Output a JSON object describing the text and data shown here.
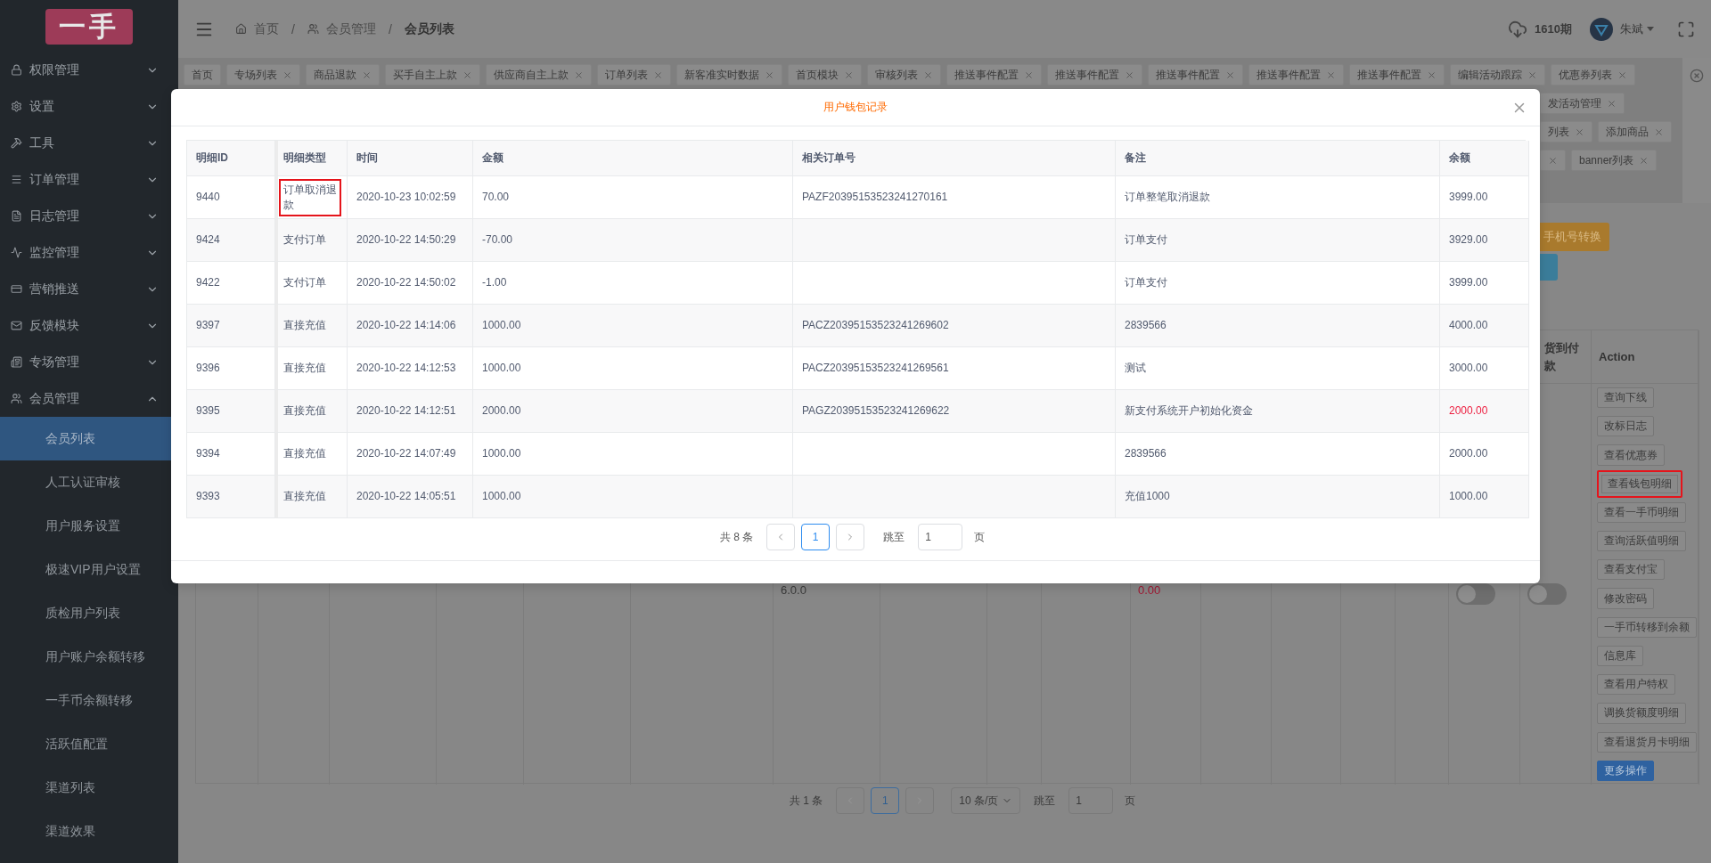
{
  "sidebar": {
    "logo": "一手",
    "items": [
      {
        "label": "权限管理",
        "expanded": false
      },
      {
        "label": "设置",
        "expanded": false
      },
      {
        "label": "工具",
        "expanded": false
      },
      {
        "label": "订单管理",
        "expanded": false
      },
      {
        "label": "日志管理",
        "expanded": false
      },
      {
        "label": "监控管理",
        "expanded": false
      },
      {
        "label": "营销推送",
        "expanded": false
      },
      {
        "label": "反馈模块",
        "expanded": false
      },
      {
        "label": "专场管理",
        "expanded": false
      },
      {
        "label": "会员管理",
        "expanded": true,
        "children": [
          {
            "label": "会员列表",
            "selected": true
          },
          {
            "label": "人工认证审核",
            "selected": false
          },
          {
            "label": "用户服务设置",
            "selected": false
          },
          {
            "label": "极速VIP用户设置",
            "selected": false
          },
          {
            "label": "质检用户列表",
            "selected": false
          },
          {
            "label": "用户账户余额转移",
            "selected": false
          },
          {
            "label": "一手币余额转移",
            "selected": false
          },
          {
            "label": "活跃值配置",
            "selected": false
          },
          {
            "label": "渠道列表",
            "selected": false
          },
          {
            "label": "渠道效果",
            "selected": false
          }
        ]
      }
    ]
  },
  "header": {
    "breadcrumb": [
      {
        "label": "首页",
        "current": false
      },
      {
        "label": "会员管理",
        "current": false
      },
      {
        "label": "会员列表",
        "current": true
      }
    ],
    "separators": [
      "/",
      "/"
    ],
    "period": "1610期",
    "user": "朱斌"
  },
  "tab_rows": [
    {
      "tabs": [
        {
          "label": "首页",
          "closable": false
        },
        {
          "label": "专场列表",
          "closable": true
        },
        {
          "label": "商品退款",
          "closable": true
        },
        {
          "label": "买手自主上款",
          "closable": true
        },
        {
          "label": "供应商自主上款",
          "closable": true
        },
        {
          "label": "订单列表",
          "closable": true
        },
        {
          "label": "新客准实时数据",
          "closable": true
        },
        {
          "label": "首页模块",
          "closable": true
        },
        {
          "label": "审核列表",
          "closable": true
        },
        {
          "label": "推送事件配置",
          "closable": true
        },
        {
          "label": "推送事件配置",
          "closable": true
        },
        {
          "label": "推送事件配置",
          "closable": true
        },
        {
          "label": "推送事件配置",
          "closable": true
        },
        {
          "label": "推送事件配置",
          "closable": true
        },
        {
          "label": "编辑活动跟踪",
          "closable": true
        },
        {
          "label": "优惠券列表",
          "closable": true
        }
      ]
    },
    {
      "tabs": [
        {
          "label": "发活动管理",
          "closable": true
        }
      ]
    },
    {
      "tabs": [
        {
          "label": "列表",
          "closable": true
        },
        {
          "label": "添加商品",
          "closable": true
        }
      ]
    },
    {
      "tabs": [
        {
          "closable": true
        },
        {
          "label": "banner列表",
          "closable": true
        }
      ]
    }
  ],
  "side_buttons": [
    {
      "label": "手机号转换",
      "kind": "warning"
    },
    {
      "kind": "primary"
    }
  ],
  "member_table": {
    "columns": [
      {},
      {},
      {},
      {},
      {},
      {},
      {
        "cell": {
          "kind": "text",
          "text": "6.0.0"
        }
      },
      {},
      {},
      {},
      {
        "cell": {
          "kind": "money",
          "text": "0.00"
        }
      },
      {},
      {},
      {},
      {},
      {
        "cell": {
          "kind": "switch",
          "on": false
        }
      },
      {
        "header": "货到付款",
        "cell": {
          "kind": "switch",
          "on": false
        }
      },
      {
        "header": "Action",
        "cell": {
          "kind": "actions"
        }
      }
    ],
    "actions": [
      {
        "label": "查询下线",
        "kind": "default",
        "highlighted": false
      },
      {
        "label": "改标日志",
        "kind": "default",
        "highlighted": false
      },
      {
        "label": "查看优惠券",
        "kind": "default",
        "highlighted": false
      },
      {
        "label": "查看钱包明细",
        "kind": "default",
        "highlighted": true
      },
      {
        "label": "查看一手币明细",
        "kind": "default",
        "highlighted": false
      },
      {
        "label": "查询活跃值明细",
        "kind": "default",
        "highlighted": false
      },
      {
        "label": "查看支付宝",
        "kind": "default",
        "highlighted": false
      },
      {
        "label": "修改密码",
        "kind": "default",
        "highlighted": false
      },
      {
        "label": "一手币转移到余额",
        "kind": "default",
        "highlighted": false
      },
      {
        "label": "信息库",
        "kind": "default",
        "highlighted": false
      },
      {
        "label": "查看用户特权",
        "kind": "default",
        "highlighted": false
      },
      {
        "label": "调换货额度明细",
        "kind": "default",
        "highlighted": false
      },
      {
        "label": "查看退货月卡明细",
        "kind": "default",
        "highlighted": false
      },
      {
        "label": "更多操作",
        "kind": "primary",
        "highlighted": false
      }
    ]
  },
  "pagination": {
    "total": "共 1 条",
    "pages": [
      {
        "label": "1",
        "selected": true
      }
    ],
    "page_size": "10 条/页",
    "jump_label": "跳至",
    "jump_value": "1",
    "unit": "页"
  },
  "modal": {
    "title": "用户钱包记录",
    "columns": [
      "明细ID",
      "明细类型",
      "时间",
      "金额",
      "相关订单号",
      "备注",
      "余额"
    ],
    "rows": [
      {
        "id": "9440",
        "type": "订单取消退款",
        "time": "2020-10-23 10:02:59",
        "amount": "70.00",
        "order_no": "PAZF20395153523241270161",
        "note": "订单整笔取消退款",
        "balance": "3999.00",
        "type_highlighted": true,
        "balance_alert": false
      },
      {
        "id": "9424",
        "type": "支付订单",
        "time": "2020-10-22 14:50:29",
        "amount": "-70.00",
        "note": "订单支付",
        "balance": "3929.00",
        "type_highlighted": false,
        "balance_alert": false
      },
      {
        "id": "9422",
        "type": "支付订单",
        "time": "2020-10-22 14:50:02",
        "amount": "-1.00",
        "note": "订单支付",
        "balance": "3999.00",
        "type_highlighted": false,
        "balance_alert": false
      },
      {
        "id": "9397",
        "type": "直接充值",
        "time": "2020-10-22 14:14:06",
        "amount": "1000.00",
        "order_no": "PACZ20395153523241269602",
        "note": "2839566",
        "balance": "4000.00",
        "type_highlighted": false,
        "balance_alert": false
      },
      {
        "id": "9396",
        "type": "直接充值",
        "time": "2020-10-22 14:12:53",
        "amount": "1000.00",
        "order_no": "PACZ20395153523241269561",
        "note": "测试",
        "balance": "3000.00",
        "type_highlighted": false,
        "balance_alert": false
      },
      {
        "id": "9395",
        "type": "直接充值",
        "time": "2020-10-22 14:12:51",
        "amount": "2000.00",
        "order_no": "PAGZ20395153523241269622",
        "note": "新支付系统开户初始化资金",
        "balance": "2000.00",
        "type_highlighted": false,
        "balance_alert": true
      },
      {
        "id": "9394",
        "type": "直接充值",
        "time": "2020-10-22 14:07:49",
        "amount": "1000.00",
        "note": "2839566",
        "balance": "2000.00",
        "type_highlighted": false,
        "balance_alert": false
      },
      {
        "id": "9393",
        "type": "直接充值",
        "time": "2020-10-22 14:05:51",
        "amount": "1000.00",
        "note": "充值1000",
        "balance": "1000.00",
        "type_highlighted": false,
        "balance_alert": false
      }
    ],
    "pagination": {
      "total": "共 8 条",
      "pages": [
        {
          "label": "1",
          "selected": true
        }
      ],
      "jump_label": "跳至",
      "jump_value": "1",
      "unit": "页"
    }
  }
}
